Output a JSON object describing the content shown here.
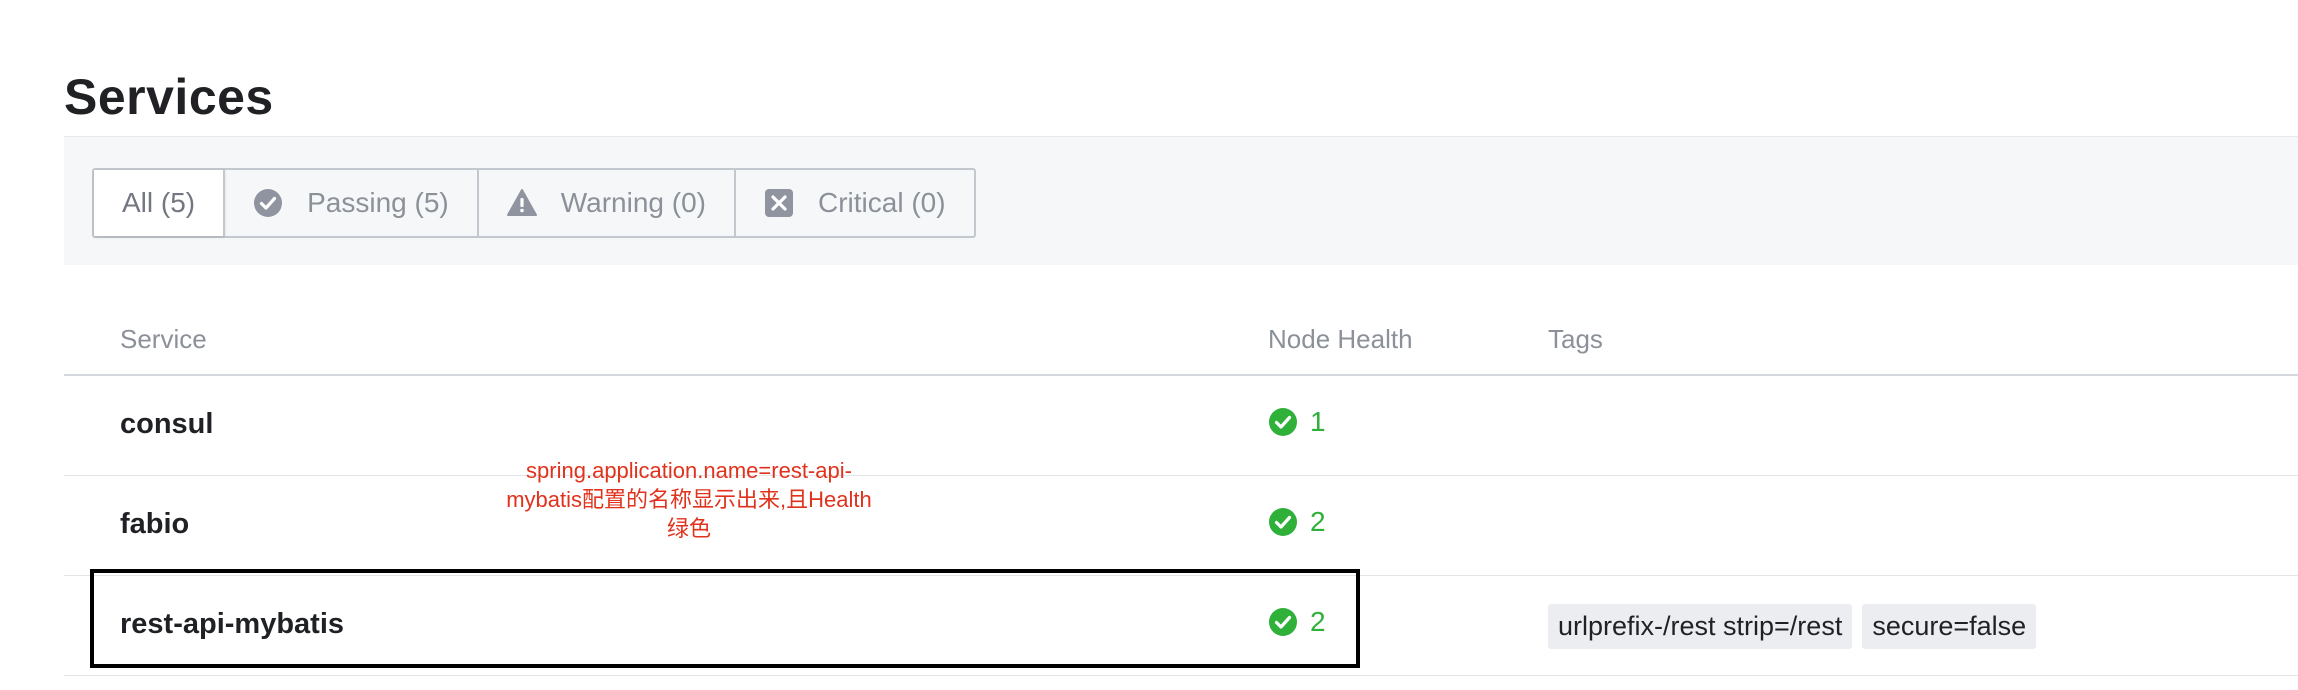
{
  "page": {
    "title": "Services"
  },
  "filters": [
    {
      "label": "All (5)",
      "icon": "",
      "active": true
    },
    {
      "label": "Passing (5)",
      "icon": "check-circle-icon",
      "active": false
    },
    {
      "label": "Warning (0)",
      "icon": "warning-triangle-icon",
      "active": false
    },
    {
      "label": "Critical (0)",
      "icon": "critical-x-icon",
      "active": false
    }
  ],
  "table": {
    "columns": [
      "Service",
      "Node Health",
      "Tags"
    ],
    "rows": [
      {
        "name": "consul",
        "health": "1",
        "tags": []
      },
      {
        "name": "fabio",
        "health": "2",
        "tags": []
      },
      {
        "name": "rest-api-mybatis",
        "health": "2",
        "tags": [
          "urlprefix-/rest strip=/rest",
          "secure=false"
        ]
      }
    ]
  },
  "annotation": {
    "line1": "spring.application.name=rest-api-",
    "line2": "mybatis配置的名称显示出来,且Health",
    "line3": "绿色"
  },
  "colors": {
    "passing_green": "#2eb039",
    "annotation_red": "#e0321c",
    "muted_text": "#8b9099",
    "highlight_border": "#000000"
  }
}
